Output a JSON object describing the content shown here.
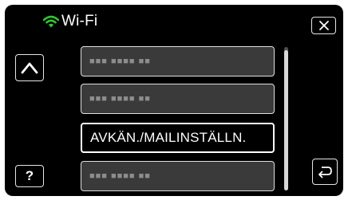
{
  "header": {
    "title": "Wi-Fi",
    "wifi_icon_color": "#2fc42f"
  },
  "buttons": {
    "close_icon": "close-icon",
    "up_icon": "chevron-up-icon",
    "help_label": "?",
    "back_icon": "return-arrow-icon"
  },
  "list": {
    "items": [
      {
        "label": "■■■ ■■■■ ■■",
        "placeholder": true
      },
      {
        "label": "■■■ ■■■■ ■■",
        "placeholder": true
      },
      {
        "label": "AVKÄN./MAILINSTÄLLN.",
        "placeholder": false,
        "selected": true
      },
      {
        "label": "■■■ ■■■■ ■■",
        "placeholder": true
      }
    ]
  }
}
